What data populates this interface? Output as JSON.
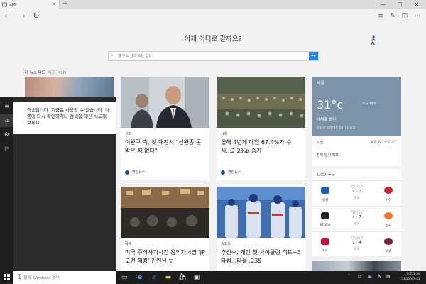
{
  "browser": {
    "tab_title": "시작",
    "new_tab_symbol": "+",
    "tab_close_symbol": "✕",
    "window_min": "—",
    "window_max": "☐",
    "window_close": "✕"
  },
  "headline": "이제 어디로 갈까요?",
  "search": {
    "placeholder": "웹 주소 검색 또는 입력"
  },
  "feed": {
    "label": "내 뉴스 피드",
    "source": "제공: MSN"
  },
  "cards": [
    {
      "category": "사회",
      "title": "이완구 측, 첫 재판서 \"성완종 돈 받은 적 없다\"",
      "publisher": "연합뉴스"
    },
    {
      "category": "사회",
      "title": "올해 4년제 대입 67.4%가 수시...2.2%p 증가",
      "publisher": "연합뉴스"
    },
    {
      "category": "국제",
      "title": "미국 주식사기시건 용의자 4명 'JP모건 해킹' 관련된 듯"
    },
    {
      "category": "스포츠",
      "title": "추신수, 개인 첫 사이클링 히트+3타점...타율 .235"
    }
  ],
  "weather": {
    "city": "서울",
    "temp": "31°c",
    "wind": "2 m/s",
    "condition": "대체로 흐림",
    "updated": "마지막 업데이트 01:37 오후",
    "today": "오늘",
    "high": "높음 32°",
    "low": "낮음 25°",
    "full_link": "전체 일기 예보"
  },
  "baseball": {
    "header": "프로야구 >",
    "games": [
      {
        "date": "7월 21일",
        "score": "1 - 2",
        "status": "종료",
        "home": "삼성",
        "away": "기아"
      },
      {
        "date": "7월 21일",
        "score": "4 - 7",
        "status": "종료",
        "home": "KT Wiz",
        "away": "한화"
      },
      {
        "date": "7월 21일",
        "score": "1 - 4",
        "status": "종료",
        "home": "LG",
        "away": "넥센"
      }
    ]
  },
  "cortana": {
    "message": "죄송합니다. 지금은 사용할 수 없습니다. 나중에 다시 확인하거나 검색을 대신 시도해 보세요."
  },
  "taskbar": {
    "search_placeholder": "웹 및 Windows 검색",
    "time": "오후 1:49",
    "date": "2015-07-22"
  },
  "colors": {
    "accent": "#1e8cf0",
    "weather_bg": "#7c93a8",
    "taskbar": "#1d1d1d",
    "cortana_bg": "#2b2b2b"
  }
}
